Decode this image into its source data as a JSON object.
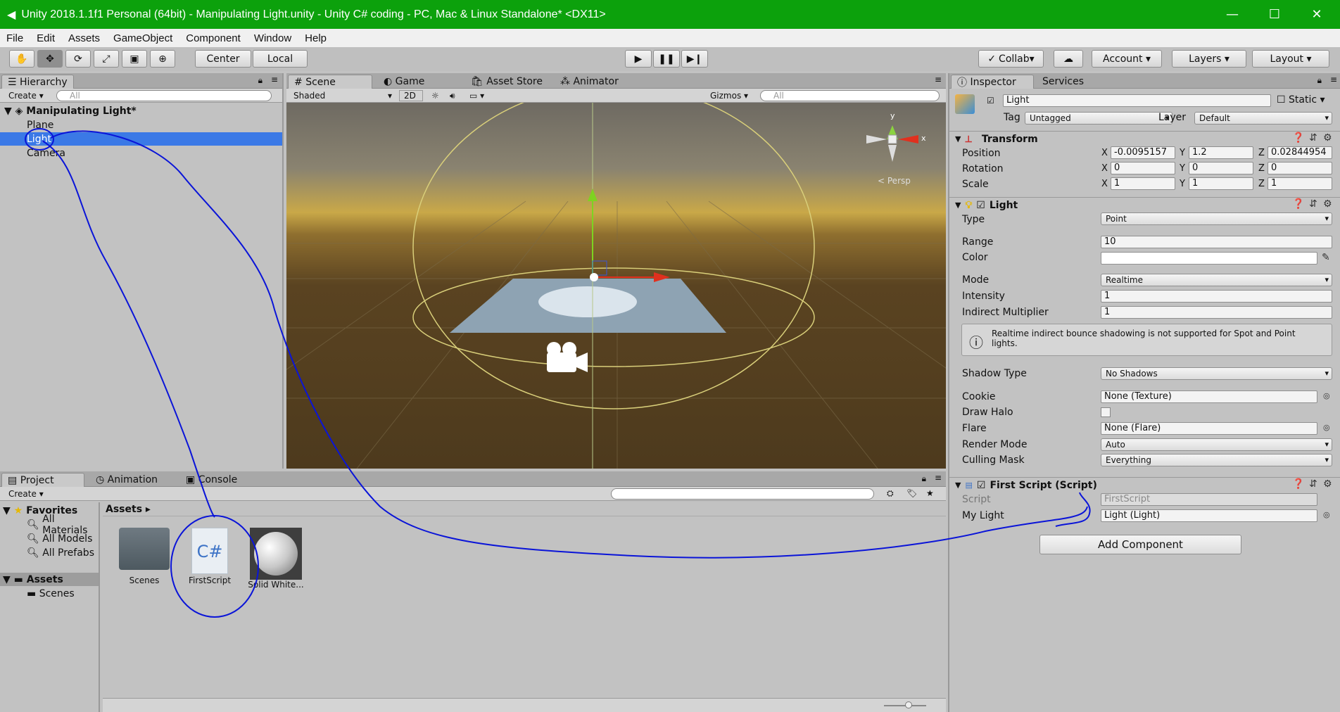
{
  "window": {
    "title": "Unity 2018.1.1f1 Personal (64bit) - Manipulating Light.unity - Unity C# coding - PC, Mac & Linux Standalone* <DX11>",
    "minimize": "—",
    "maximize": "☐",
    "close": "✕"
  },
  "menu": [
    "File",
    "Edit",
    "Assets",
    "GameObject",
    "Component",
    "Window",
    "Help"
  ],
  "toolbar": {
    "center": "Center",
    "local": "Local",
    "collab": "Collab",
    "account": "Account",
    "layers": "Layers",
    "layout": "Layout"
  },
  "hierarchy": {
    "tab": "Hierarchy",
    "create": "Create",
    "search_placeholder": "All",
    "scene": "Manipulating Light*",
    "items": [
      "Plane",
      "Light",
      "Camera"
    ],
    "selected_index": 1
  },
  "scene": {
    "tabs": [
      "Scene",
      "Game",
      "Asset Store",
      "Animator"
    ],
    "shading": "Shaded",
    "mode2d": "2D",
    "gizmos": "Gizmos",
    "search_placeholder": "All",
    "persp": "Persp",
    "axis_y": "y",
    "axis_x": "x"
  },
  "project": {
    "tabs": [
      "Project",
      "Animation",
      "Console"
    ],
    "create": "Create",
    "favorites": "Favorites",
    "fav_items": [
      "All Materials",
      "All Models",
      "All Prefabs"
    ],
    "assets_root": "Assets",
    "assets_children": [
      "Scenes"
    ],
    "breadcrumb": "Assets",
    "files": [
      {
        "name": "Scenes",
        "kind": "folder"
      },
      {
        "name": "FirstScript",
        "kind": "csharp"
      },
      {
        "name": "Solid White...",
        "kind": "material"
      }
    ]
  },
  "inspector": {
    "tabs": [
      "Inspector",
      "Services"
    ],
    "object_name": "Light",
    "static": "Static",
    "tag_label": "Tag",
    "tag": "Untagged",
    "layer_label": "Layer",
    "layer": "Default",
    "transform": {
      "title": "Transform",
      "position_label": "Position",
      "rotation_label": "Rotation",
      "scale_label": "Scale",
      "position": [
        "-0.0095157",
        "1.2",
        "0.02844954"
      ],
      "rotation": [
        "0",
        "0",
        "0"
      ],
      "scale": [
        "1",
        "1",
        "1"
      ],
      "axes": [
        "X",
        "Y",
        "Z"
      ]
    },
    "light": {
      "title": "Light",
      "type_label": "Type",
      "type": "Point",
      "range_label": "Range",
      "range": "10",
      "color_label": "Color",
      "mode_label": "Mode",
      "mode": "Realtime",
      "intensity_label": "Intensity",
      "intensity": "1",
      "indirect_label": "Indirect Multiplier",
      "indirect": "1",
      "warning": "Realtime indirect bounce shadowing is not supported for Spot and Point lights.",
      "shadow_label": "Shadow Type",
      "shadow": "No Shadows",
      "cookie_label": "Cookie",
      "cookie": "None (Texture)",
      "halo_label": "Draw Halo",
      "flare_label": "Flare",
      "flare": "None (Flare)",
      "render_label": "Render Mode",
      "render": "Auto",
      "culling_label": "Culling Mask",
      "culling": "Everything"
    },
    "script": {
      "title": "First Script (Script)",
      "script_label": "Script",
      "script": "FirstScript",
      "mylight_label": "My Light",
      "mylight": "Light (Light)"
    },
    "add_component": "Add Component"
  },
  "annotation_color": "#0a14d8"
}
